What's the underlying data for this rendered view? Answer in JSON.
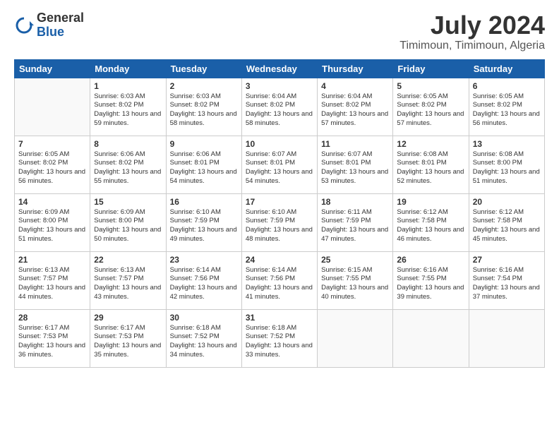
{
  "logo": {
    "general": "General",
    "blue": "Blue"
  },
  "title": "July 2024",
  "location": "Timimoun, Timimoun, Algeria",
  "days_header": [
    "Sunday",
    "Monday",
    "Tuesday",
    "Wednesday",
    "Thursday",
    "Friday",
    "Saturday"
  ],
  "weeks": [
    [
      {
        "day": "",
        "sunrise": "",
        "sunset": "",
        "daylight": ""
      },
      {
        "day": "1",
        "sunrise": "Sunrise: 6:03 AM",
        "sunset": "Sunset: 8:02 PM",
        "daylight": "Daylight: 13 hours and 59 minutes."
      },
      {
        "day": "2",
        "sunrise": "Sunrise: 6:03 AM",
        "sunset": "Sunset: 8:02 PM",
        "daylight": "Daylight: 13 hours and 58 minutes."
      },
      {
        "day": "3",
        "sunrise": "Sunrise: 6:04 AM",
        "sunset": "Sunset: 8:02 PM",
        "daylight": "Daylight: 13 hours and 58 minutes."
      },
      {
        "day": "4",
        "sunrise": "Sunrise: 6:04 AM",
        "sunset": "Sunset: 8:02 PM",
        "daylight": "Daylight: 13 hours and 57 minutes."
      },
      {
        "day": "5",
        "sunrise": "Sunrise: 6:05 AM",
        "sunset": "Sunset: 8:02 PM",
        "daylight": "Daylight: 13 hours and 57 minutes."
      },
      {
        "day": "6",
        "sunrise": "Sunrise: 6:05 AM",
        "sunset": "Sunset: 8:02 PM",
        "daylight": "Daylight: 13 hours and 56 minutes."
      }
    ],
    [
      {
        "day": "7",
        "sunrise": "Sunrise: 6:05 AM",
        "sunset": "Sunset: 8:02 PM",
        "daylight": "Daylight: 13 hours and 56 minutes."
      },
      {
        "day": "8",
        "sunrise": "Sunrise: 6:06 AM",
        "sunset": "Sunset: 8:02 PM",
        "daylight": "Daylight: 13 hours and 55 minutes."
      },
      {
        "day": "9",
        "sunrise": "Sunrise: 6:06 AM",
        "sunset": "Sunset: 8:01 PM",
        "daylight": "Daylight: 13 hours and 54 minutes."
      },
      {
        "day": "10",
        "sunrise": "Sunrise: 6:07 AM",
        "sunset": "Sunset: 8:01 PM",
        "daylight": "Daylight: 13 hours and 54 minutes."
      },
      {
        "day": "11",
        "sunrise": "Sunrise: 6:07 AM",
        "sunset": "Sunset: 8:01 PM",
        "daylight": "Daylight: 13 hours and 53 minutes."
      },
      {
        "day": "12",
        "sunrise": "Sunrise: 6:08 AM",
        "sunset": "Sunset: 8:01 PM",
        "daylight": "Daylight: 13 hours and 52 minutes."
      },
      {
        "day": "13",
        "sunrise": "Sunrise: 6:08 AM",
        "sunset": "Sunset: 8:00 PM",
        "daylight": "Daylight: 13 hours and 51 minutes."
      }
    ],
    [
      {
        "day": "14",
        "sunrise": "Sunrise: 6:09 AM",
        "sunset": "Sunset: 8:00 PM",
        "daylight": "Daylight: 13 hours and 51 minutes."
      },
      {
        "day": "15",
        "sunrise": "Sunrise: 6:09 AM",
        "sunset": "Sunset: 8:00 PM",
        "daylight": "Daylight: 13 hours and 50 minutes."
      },
      {
        "day": "16",
        "sunrise": "Sunrise: 6:10 AM",
        "sunset": "Sunset: 7:59 PM",
        "daylight": "Daylight: 13 hours and 49 minutes."
      },
      {
        "day": "17",
        "sunrise": "Sunrise: 6:10 AM",
        "sunset": "Sunset: 7:59 PM",
        "daylight": "Daylight: 13 hours and 48 minutes."
      },
      {
        "day": "18",
        "sunrise": "Sunrise: 6:11 AM",
        "sunset": "Sunset: 7:59 PM",
        "daylight": "Daylight: 13 hours and 47 minutes."
      },
      {
        "day": "19",
        "sunrise": "Sunrise: 6:12 AM",
        "sunset": "Sunset: 7:58 PM",
        "daylight": "Daylight: 13 hours and 46 minutes."
      },
      {
        "day": "20",
        "sunrise": "Sunrise: 6:12 AM",
        "sunset": "Sunset: 7:58 PM",
        "daylight": "Daylight: 13 hours and 45 minutes."
      }
    ],
    [
      {
        "day": "21",
        "sunrise": "Sunrise: 6:13 AM",
        "sunset": "Sunset: 7:57 PM",
        "daylight": "Daylight: 13 hours and 44 minutes."
      },
      {
        "day": "22",
        "sunrise": "Sunrise: 6:13 AM",
        "sunset": "Sunset: 7:57 PM",
        "daylight": "Daylight: 13 hours and 43 minutes."
      },
      {
        "day": "23",
        "sunrise": "Sunrise: 6:14 AM",
        "sunset": "Sunset: 7:56 PM",
        "daylight": "Daylight: 13 hours and 42 minutes."
      },
      {
        "day": "24",
        "sunrise": "Sunrise: 6:14 AM",
        "sunset": "Sunset: 7:56 PM",
        "daylight": "Daylight: 13 hours and 41 minutes."
      },
      {
        "day": "25",
        "sunrise": "Sunrise: 6:15 AM",
        "sunset": "Sunset: 7:55 PM",
        "daylight": "Daylight: 13 hours and 40 minutes."
      },
      {
        "day": "26",
        "sunrise": "Sunrise: 6:16 AM",
        "sunset": "Sunset: 7:55 PM",
        "daylight": "Daylight: 13 hours and 39 minutes."
      },
      {
        "day": "27",
        "sunrise": "Sunrise: 6:16 AM",
        "sunset": "Sunset: 7:54 PM",
        "daylight": "Daylight: 13 hours and 37 minutes."
      }
    ],
    [
      {
        "day": "28",
        "sunrise": "Sunrise: 6:17 AM",
        "sunset": "Sunset: 7:53 PM",
        "daylight": "Daylight: 13 hours and 36 minutes."
      },
      {
        "day": "29",
        "sunrise": "Sunrise: 6:17 AM",
        "sunset": "Sunset: 7:53 PM",
        "daylight": "Daylight: 13 hours and 35 minutes."
      },
      {
        "day": "30",
        "sunrise": "Sunrise: 6:18 AM",
        "sunset": "Sunset: 7:52 PM",
        "daylight": "Daylight: 13 hours and 34 minutes."
      },
      {
        "day": "31",
        "sunrise": "Sunrise: 6:18 AM",
        "sunset": "Sunset: 7:52 PM",
        "daylight": "Daylight: 13 hours and 33 minutes."
      },
      {
        "day": "",
        "sunrise": "",
        "sunset": "",
        "daylight": ""
      },
      {
        "day": "",
        "sunrise": "",
        "sunset": "",
        "daylight": ""
      },
      {
        "day": "",
        "sunrise": "",
        "sunset": "",
        "daylight": ""
      }
    ]
  ]
}
